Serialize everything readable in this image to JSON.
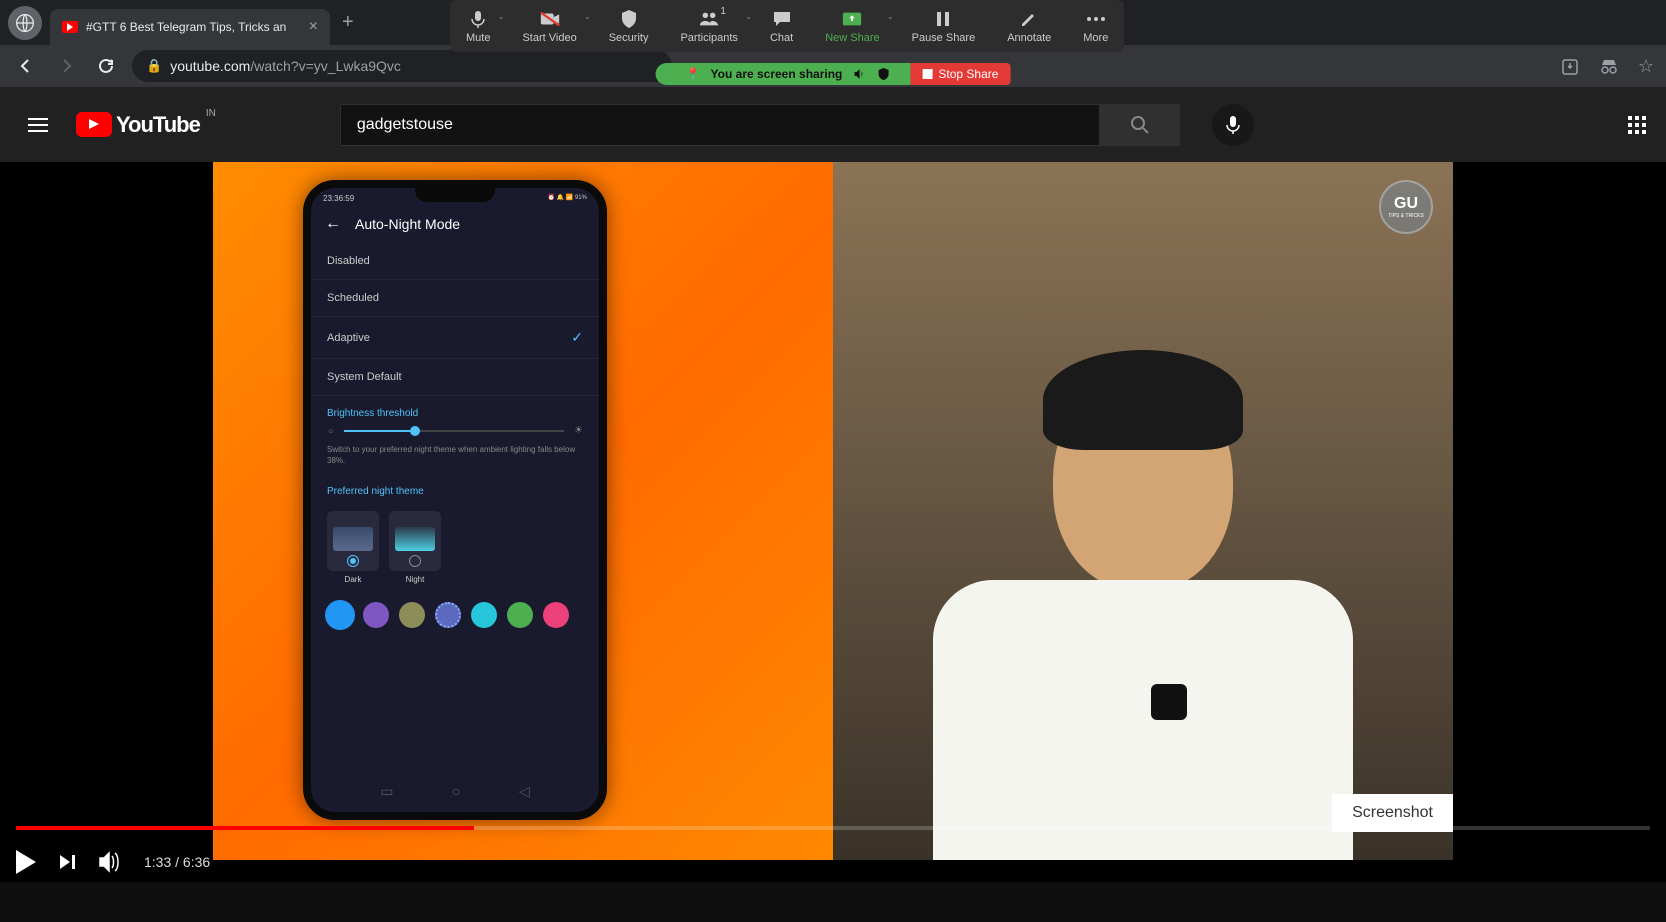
{
  "browser": {
    "tab_title": "#GTT 6 Best Telegram Tips, Tricks an",
    "url_domain": "youtube.com",
    "url_path": "/watch?v=yv_Lwka9Qvc"
  },
  "zoom": {
    "mute": "Mute",
    "start_video": "Start Video",
    "security": "Security",
    "participants": "Participants",
    "participants_count": "1",
    "chat": "Chat",
    "new_share": "New Share",
    "pause_share": "Pause Share",
    "annotate": "Annotate",
    "more": "More",
    "sharing_text": "You are screen sharing",
    "stop_share": "Stop Share"
  },
  "youtube": {
    "logo_text": "YouTube",
    "country": "IN",
    "search_value": "gadgetstouse"
  },
  "phone": {
    "status_time": "23:36:59",
    "status_battery": "91%",
    "title": "Auto-Night Mode",
    "options": {
      "disabled": "Disabled",
      "scheduled": "Scheduled",
      "adaptive": "Adaptive",
      "system_default": "System Default"
    },
    "brightness_label": "Brightness threshold",
    "brightness_hint": "Switch to your preferred night theme when ambient lighting falls below 38%.",
    "preferred_theme_label": "Preferred night theme",
    "theme_dark": "Dark",
    "theme_night": "Night",
    "accent_colors": [
      "#2196f3",
      "#7e57c2",
      "#8d8d5a",
      "#5b6abf",
      "#26c6da",
      "#4caf50",
      "#ec407a"
    ]
  },
  "video": {
    "current_time": "1:33",
    "duration": "6:36",
    "badge_text": "TIPS & TRICKS",
    "screenshot_label": "Screenshot"
  }
}
